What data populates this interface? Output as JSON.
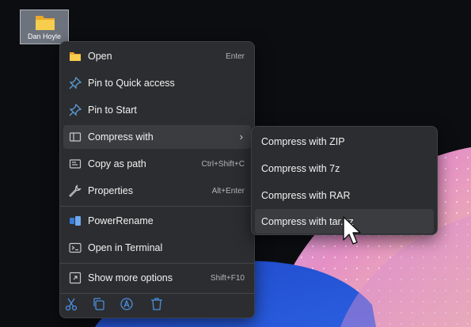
{
  "desktop": {
    "icon_label": "Dan Hoyle",
    "icon": "folder-icon"
  },
  "context_menu": {
    "items": [
      {
        "label": "Open",
        "shortcut": "Enter",
        "icon": "folder-icon"
      },
      {
        "label": "Pin to Quick access",
        "shortcut": "",
        "icon": "pin-icon"
      },
      {
        "label": "Pin to Start",
        "shortcut": "",
        "icon": "pin-icon"
      },
      {
        "label": "Compress with",
        "shortcut": "",
        "icon": "zip-icon",
        "submenu": true
      },
      {
        "label": "Copy as path",
        "shortcut": "Ctrl+Shift+C",
        "icon": "copy-path-icon"
      },
      {
        "label": "Properties",
        "shortcut": "Alt+Enter",
        "icon": "wrench-icon"
      },
      {
        "label": "PowerRename",
        "shortcut": "",
        "icon": "powerrename-icon"
      },
      {
        "label": "Open in Terminal",
        "shortcut": "",
        "icon": "terminal-icon"
      },
      {
        "label": "Show more options",
        "shortcut": "Shift+F10",
        "icon": "expand-icon"
      }
    ],
    "chevron": "›",
    "bottom_actions": [
      "cut-icon",
      "copy-icon",
      "rename-icon",
      "delete-icon"
    ]
  },
  "submenu": {
    "items": [
      {
        "label": "Compress with ZIP"
      },
      {
        "label": "Compress with 7z"
      },
      {
        "label": "Compress with RAR"
      },
      {
        "label": "Compress with tar.gz"
      }
    ]
  },
  "colors": {
    "menu_bg": "#2c2d30",
    "hover_bg": "#3b3c40",
    "folder": "#f5c543",
    "pin": "#5b9bd5",
    "accent": "#4a8fe0"
  }
}
